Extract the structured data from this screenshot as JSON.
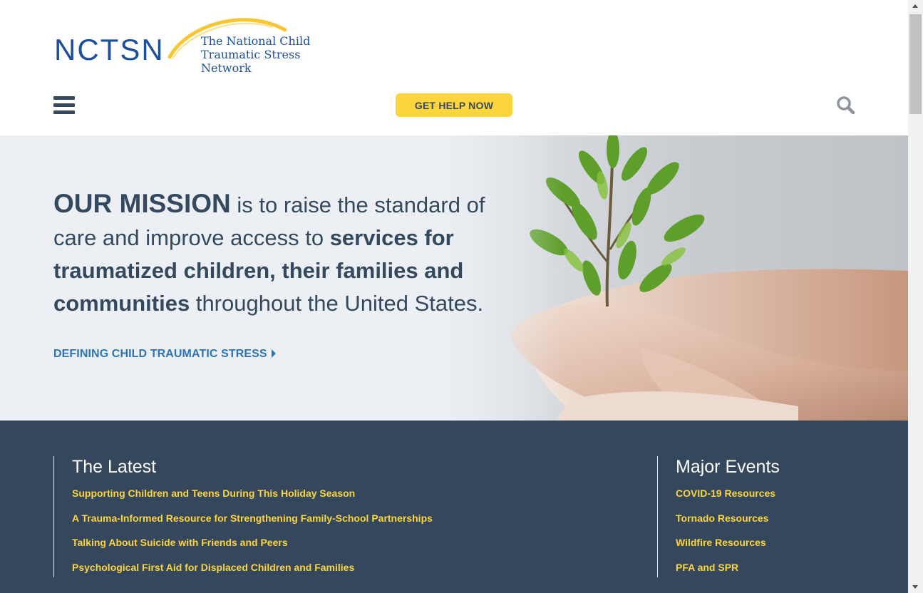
{
  "header": {
    "logo_wordmark": "NCTSN",
    "logo_line1": "The National Child",
    "logo_line2": "Traumatic Stress Network",
    "help_button": "GET HELP NOW",
    "menu_icon": "hamburger-menu-icon",
    "search_icon": "search-icon"
  },
  "hero": {
    "mission_lead": "OUR MISSION",
    "mission_text1": " is to raise the standard of care and improve access to ",
    "mission_bold": "services for traumatized children, their families and communities",
    "mission_text2": " throughout the United States.",
    "link": "DEFINING CHILD TRAUMATIC STRESS"
  },
  "latest": {
    "title": "The Latest",
    "items": [
      "Supporting Children and Teens During This Holiday Season",
      "A Trauma-Informed Resource for Strengthening Family-School Partnerships",
      "Talking About Suicide with Friends and Peers",
      "Psychological First Aid for Displaced Children and Families"
    ]
  },
  "events": {
    "title": "Major Events",
    "items": [
      "COVID-19 Resources",
      "Tornado Resources",
      "Wildfire Resources",
      "PFA and SPR"
    ]
  },
  "colors": {
    "navy": "#34495e",
    "section_bg": "#34475c",
    "accent_yellow": "#fcd43c",
    "link_blue": "#2e74b5",
    "logo_blue": "#1d4f9c"
  }
}
